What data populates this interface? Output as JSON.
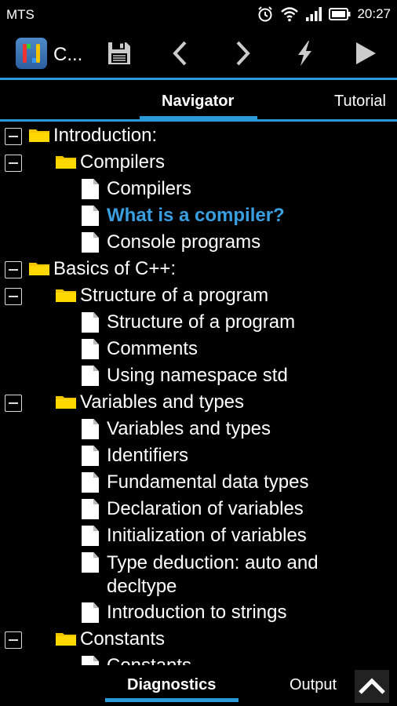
{
  "status_bar": {
    "carrier": "MTS",
    "time": "20:27"
  },
  "toolbar": {
    "app_title": "C..."
  },
  "tabs_top": [
    "Navigator",
    "Tutorial"
  ],
  "tree": [
    {
      "label": "Introduction:",
      "kind": "folder",
      "level": 0,
      "collapsible": true
    },
    {
      "label": "Compilers",
      "kind": "folder",
      "level": 1,
      "collapsible": true
    },
    {
      "label": "Compilers",
      "kind": "doc",
      "level": 2
    },
    {
      "label": "What is a compiler?",
      "kind": "doc",
      "level": 2,
      "highlight": true
    },
    {
      "label": "Console programs",
      "kind": "doc",
      "level": 2
    },
    {
      "label": "Basics of C++:",
      "kind": "folder",
      "level": 0,
      "collapsible": true
    },
    {
      "label": "Structure of a program",
      "kind": "folder",
      "level": 1,
      "collapsible": true
    },
    {
      "label": "Structure of a program",
      "kind": "doc",
      "level": 2
    },
    {
      "label": "Comments",
      "kind": "doc",
      "level": 2
    },
    {
      "label": "Using namespace std",
      "kind": "doc",
      "level": 2
    },
    {
      "label": "Variables and types",
      "kind": "folder",
      "level": 1,
      "collapsible": true
    },
    {
      "label": "Variables and types",
      "kind": "doc",
      "level": 2
    },
    {
      "label": "Identifiers",
      "kind": "doc",
      "level": 2
    },
    {
      "label": "Fundamental data types",
      "kind": "doc",
      "level": 2
    },
    {
      "label": "Declaration of variables",
      "kind": "doc",
      "level": 2
    },
    {
      "label": "Initialization of variables",
      "kind": "doc",
      "level": 2
    },
    {
      "label": "Type deduction: auto and decltype",
      "kind": "doc",
      "level": 2,
      "wrap": true
    },
    {
      "label": "Introduction to strings",
      "kind": "doc",
      "level": 2
    },
    {
      "label": "Constants",
      "kind": "folder",
      "level": 1,
      "collapsible": true
    },
    {
      "label": "Constants",
      "kind": "doc",
      "level": 2
    }
  ],
  "tabs_bottom": [
    "Diagnostics",
    "Output"
  ],
  "colors": {
    "accent": "#2b9ad8",
    "link": "#3a9fe0",
    "folder": "#f4c400"
  }
}
